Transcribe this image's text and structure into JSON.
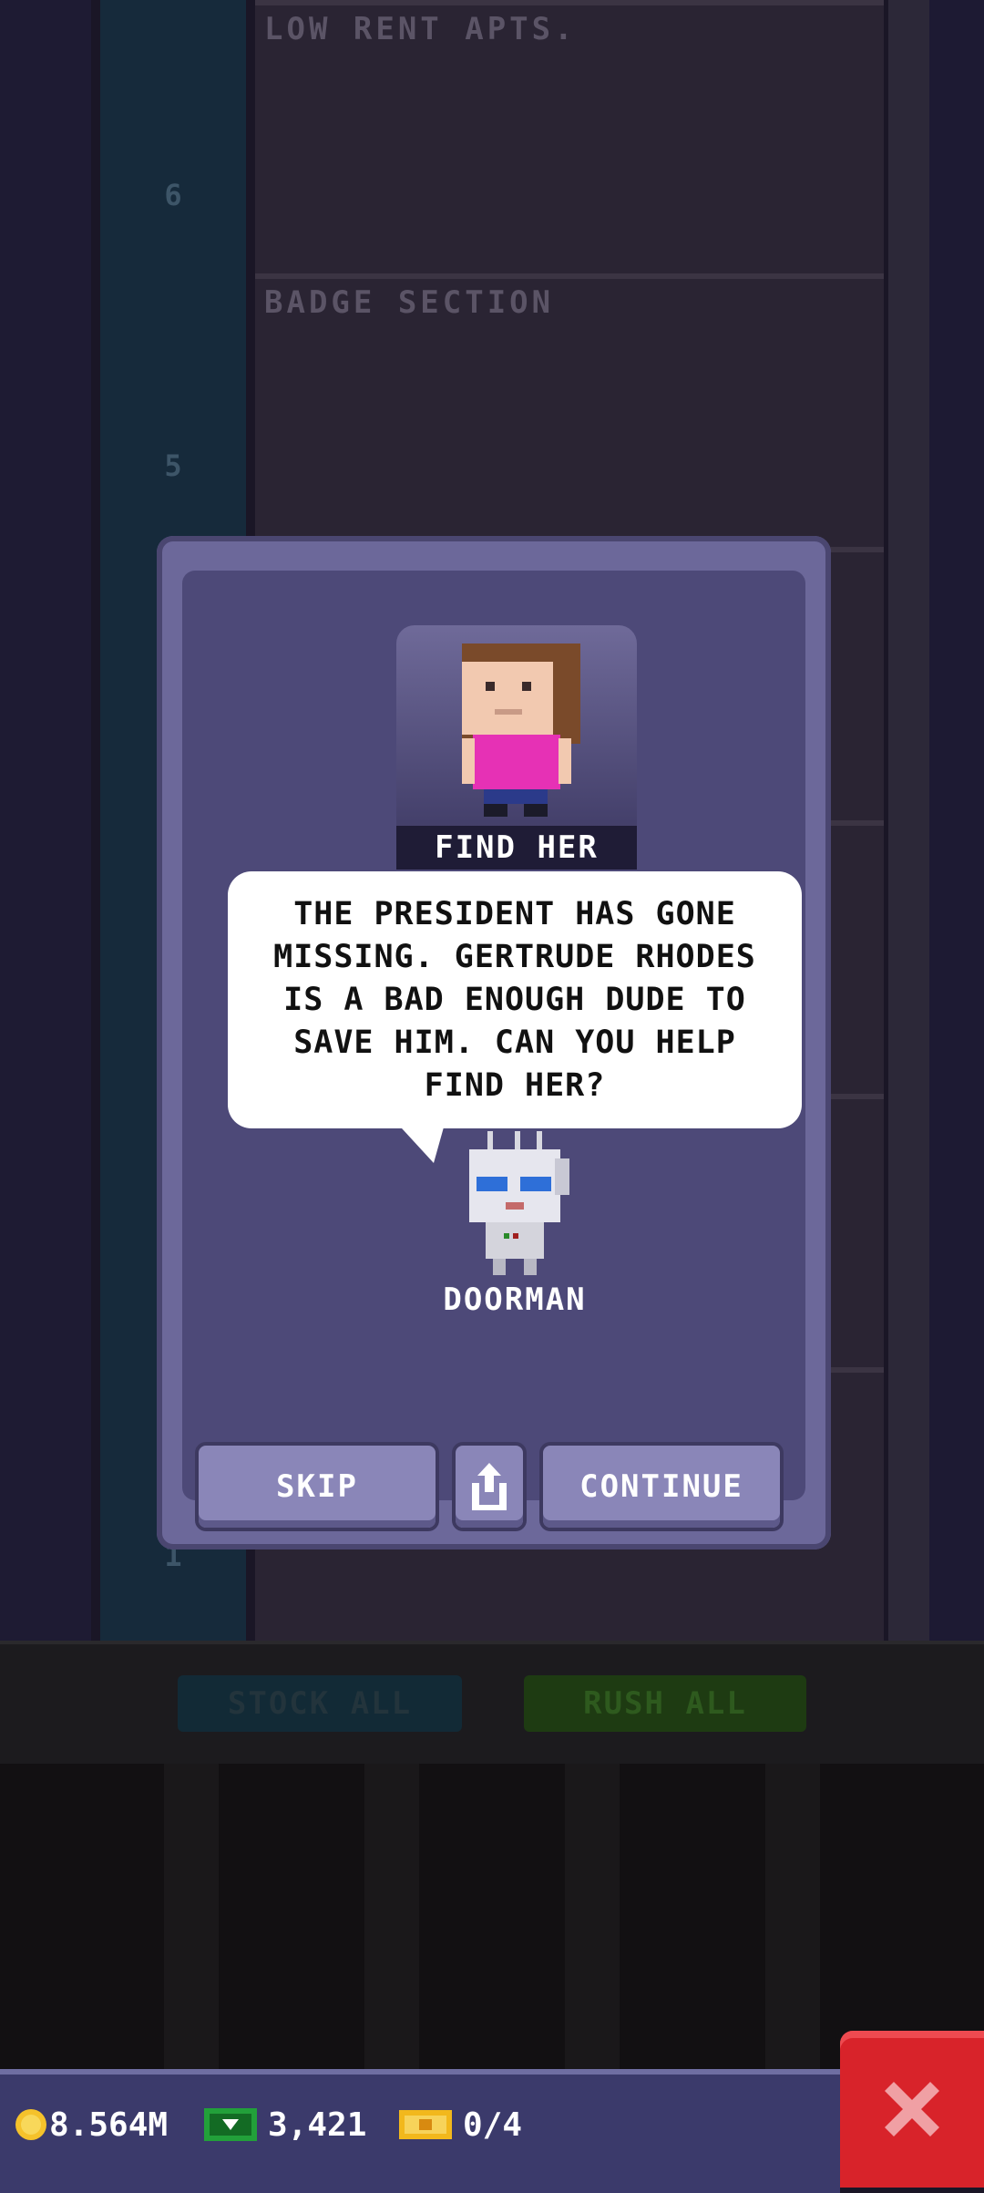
{
  "background": {
    "floors": [
      {
        "label": "LOW RENT APTS.",
        "number": "6"
      },
      {
        "label": "BADGE SECTION",
        "number": "5"
      }
    ],
    "stock_all_label": "STOCK ALL",
    "rush_all_label": "RUSH ALL",
    "floor_one_number": "1"
  },
  "dialog": {
    "portrait_caption": "FIND HER",
    "message": "THE PRESIDENT HAS GONE MISSING. GERTRUDE RHODES IS A BAD ENOUGH DUDE TO SAVE HIM. CAN YOU HELP FIND HER?",
    "speaker": "DOORMAN",
    "buttons": {
      "skip": "SKIP",
      "share_icon": "share-icon",
      "continue": "CONTINUE"
    }
  },
  "status_bar": {
    "coins": "8.564M",
    "bux": "3,421",
    "tickets": "0/4",
    "coin_icon": "coin-icon",
    "bux_icon": "bux-icon",
    "ticket_icon": "ticket-icon"
  },
  "colors": {
    "modal_frame": "#6c689a",
    "modal_inner": "#4d4978",
    "button": "#8a86b8",
    "close_button": "#d8232a",
    "status_bar": "#3b3a6b",
    "coin": "#f5c22b",
    "bux": "#22a03a"
  }
}
